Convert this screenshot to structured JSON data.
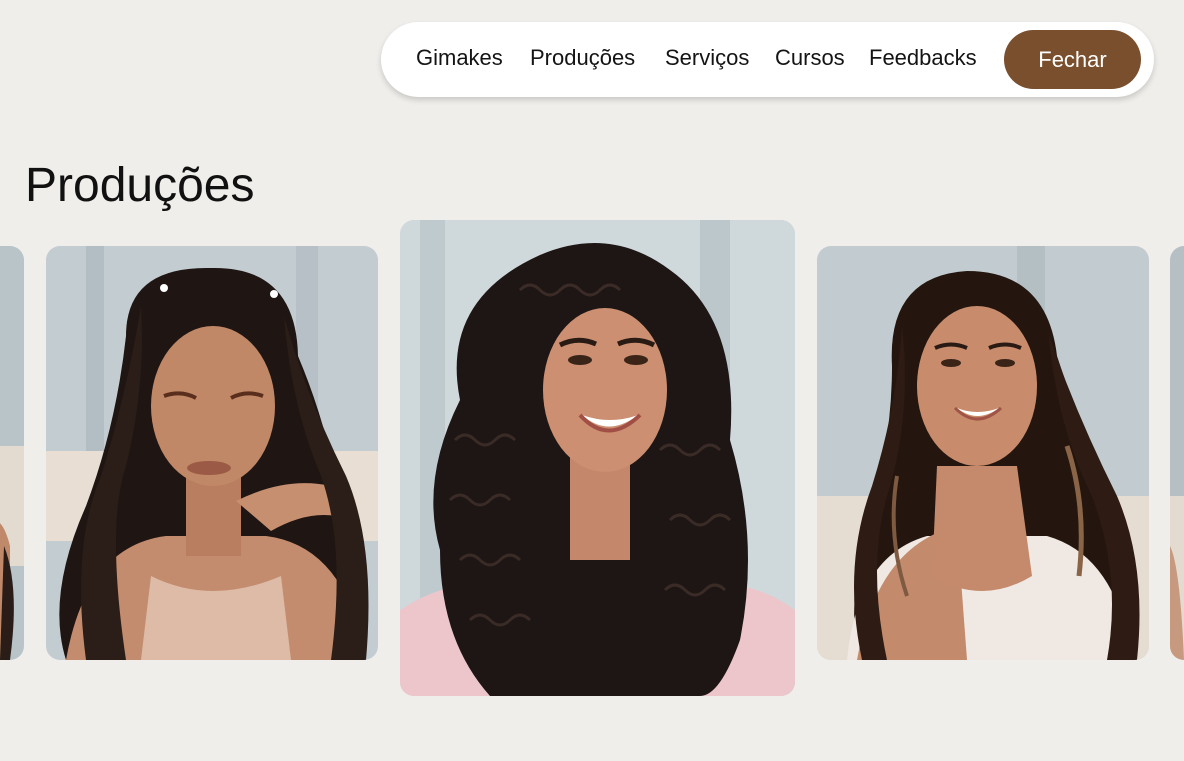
{
  "navbar": {
    "items": [
      {
        "label": "Gimakes"
      },
      {
        "label": "Produções"
      },
      {
        "label": "Serviços"
      },
      {
        "label": "Cursos"
      },
      {
        "label": "Feedbacks"
      }
    ],
    "close_label": "Fechar"
  },
  "page": {
    "title": "Produções"
  },
  "colors": {
    "background": "#f0eeeb",
    "nav_background": "#ffffff",
    "button_brown": "#7a4f2e",
    "button_text": "#ffffff"
  }
}
